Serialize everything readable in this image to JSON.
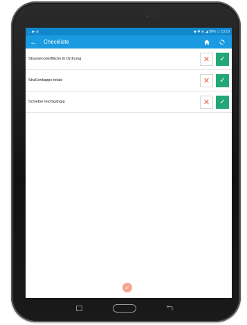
{
  "app": {
    "title": "Checkliste",
    "status_left": "↔ ▶ ◎",
    "status_right": "◆ ✱ ☰ ◢ 58% ▭ 13:16"
  },
  "icons": {
    "back": "←",
    "no": "✕",
    "yes": "✓",
    "submit": "✓"
  },
  "checklist": {
    "items": [
      {
        "label": "Strassenoberfläche in Ordnung"
      },
      {
        "label": "Straßenkappe intakt"
      },
      {
        "label": "Schieber leichtgängig"
      }
    ]
  },
  "colors": {
    "statusbar": "#1187cc",
    "appbar": "#1a9ae0",
    "accept": "#23a777",
    "reject": "#e9573f",
    "fab": "#f6a58f"
  }
}
